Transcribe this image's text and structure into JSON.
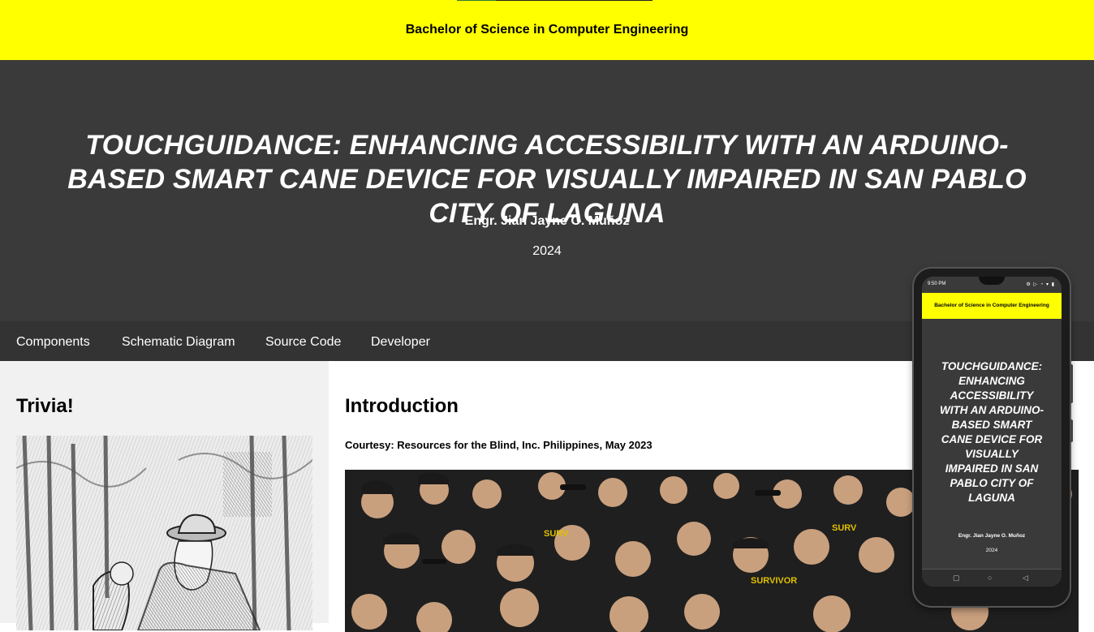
{
  "header": {
    "department": "Bachelor of Science in Computer Engineering"
  },
  "hero": {
    "title": "TOUCHGUIDANCE: ENHANCING ACCESSIBILITY WITH AN ARDUINO-BASED SMART CANE DEVICE FOR VISUALLY IMPAIRED IN SAN PABLO CITY OF LAGUNA",
    "author": "Engr. Jian Jayne O. Muñoz",
    "year": "2024"
  },
  "nav": {
    "items": [
      "Components",
      "Schematic Diagram",
      "Source Code",
      "Developer"
    ]
  },
  "sidebar": {
    "heading": "Trivia!"
  },
  "main": {
    "heading": "Introduction",
    "courtesy": "Courtesy: Resources for the Blind, Inc. Philippines, May 2023"
  },
  "phone_preview": {
    "status_time": "9:50 PM",
    "status_icons": "⚙ ▷ ◔ ▾ ▮",
    "header": "Bachelor of Science in Computer Engineering",
    "title": "TOUCHGUIDANCE: ENHANCING ACCESSIBILITY WITH AN ARDUINO-BASED SMART CANE DEVICE FOR VISUALLY IMPAIRED IN SAN PABLO CITY OF LAGUNA",
    "author": "Engr. Jian Jayne O. Muñoz",
    "year": "2024",
    "nav_square": "▢",
    "nav_circle": "○",
    "nav_back": "◁"
  },
  "colors": {
    "header_bg": "#ffff00",
    "hero_bg": "#3a3a3a",
    "nav_bg": "#333333",
    "sidebar_bg": "#f1f1f1"
  }
}
